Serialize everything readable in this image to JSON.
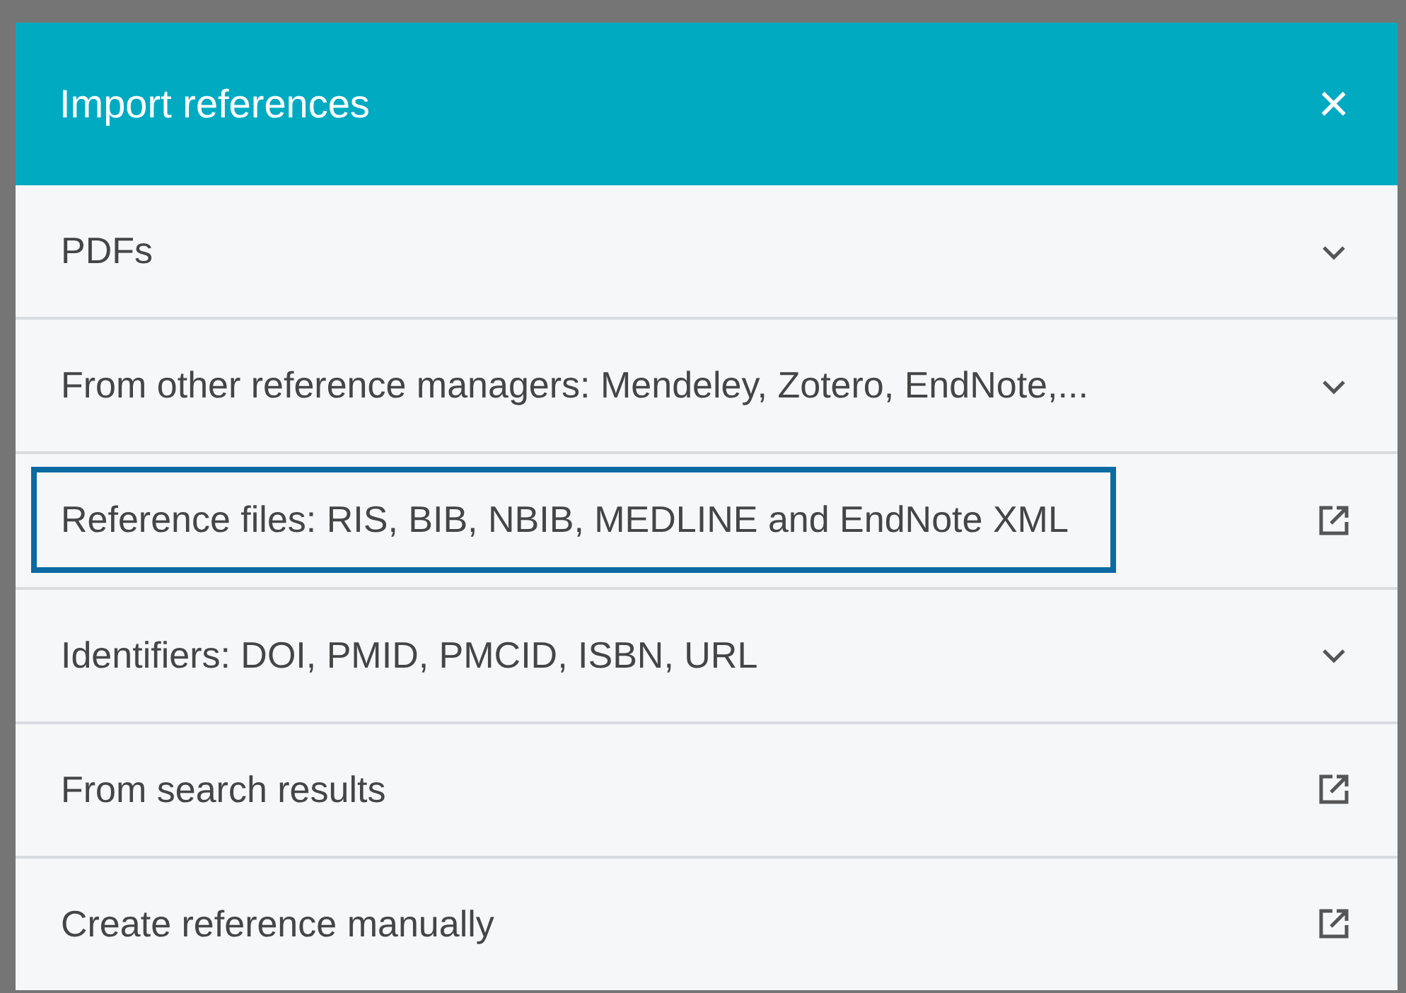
{
  "dialog": {
    "title": "Import references",
    "close": "×"
  },
  "options": [
    {
      "label": "PDFs",
      "kind": "expand",
      "focused": false
    },
    {
      "label": "From other reference managers: Mendeley, Zotero, EndNote,...",
      "kind": "expand",
      "focused": false
    },
    {
      "label": "Reference files: RIS, BIB, NBIB, MEDLINE and EndNote XML",
      "kind": "external",
      "focused": true
    },
    {
      "label": "Identifiers: DOI, PMID, PMCID, ISBN, URL",
      "kind": "expand",
      "focused": false
    },
    {
      "label": "From search results",
      "kind": "external",
      "focused": false
    },
    {
      "label": "Create reference manually",
      "kind": "external",
      "focused": false
    }
  ]
}
